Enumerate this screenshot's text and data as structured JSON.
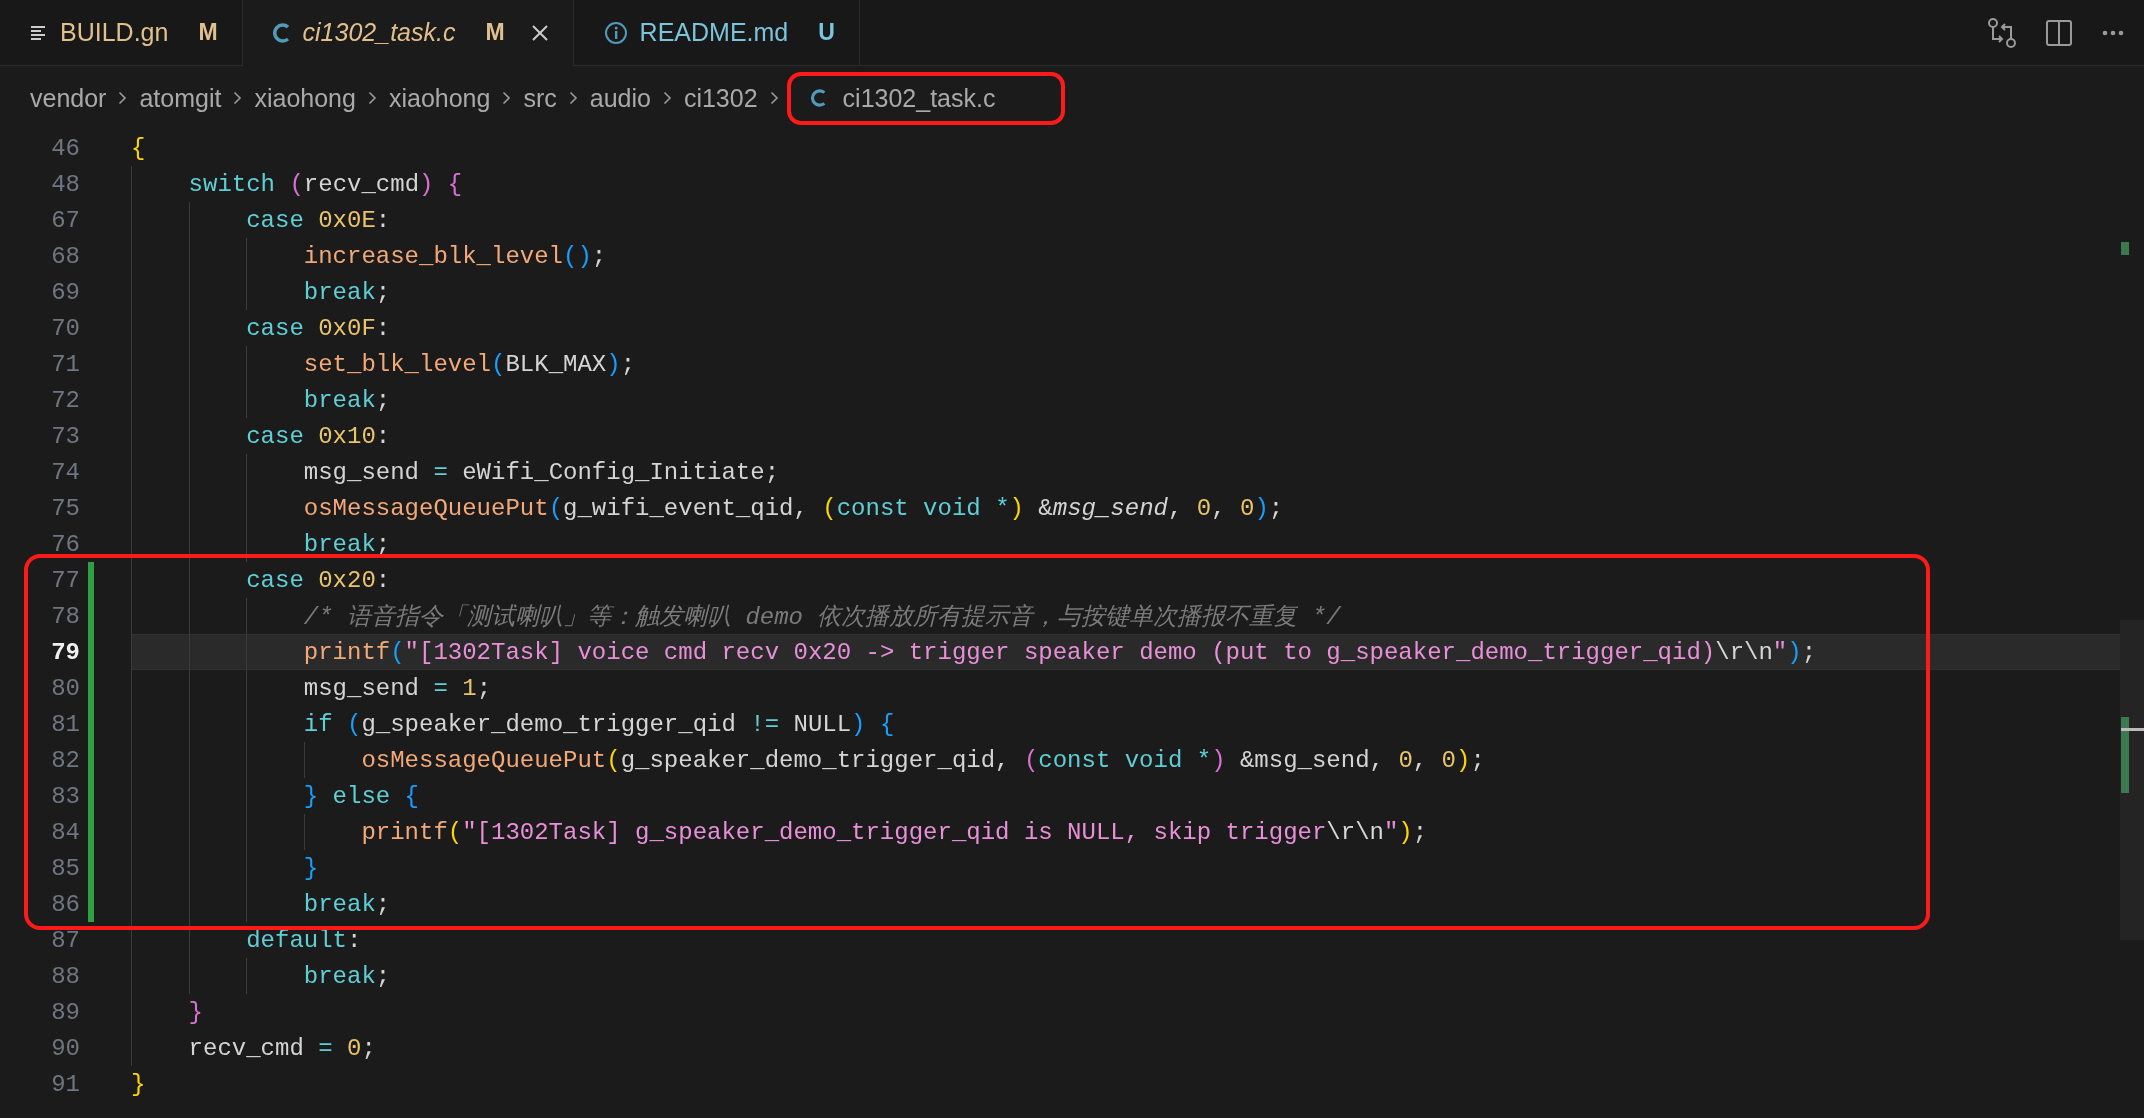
{
  "tabs": [
    {
      "label": "BUILD.gn",
      "status": "M",
      "kind": "lines",
      "selected": false,
      "italic": false,
      "closable": false,
      "color": "#e2c08d"
    },
    {
      "label": "ci1302_task.c",
      "status": "M",
      "kind": "c",
      "selected": true,
      "italic": true,
      "closable": true,
      "color": "#e2c08d"
    },
    {
      "label": "README.md",
      "status": "U",
      "kind": "info",
      "selected": false,
      "italic": false,
      "closable": false,
      "color": "#7cc3dc"
    }
  ],
  "breadcrumb": [
    {
      "label": "vendor",
      "kind": "folder",
      "boxed": false
    },
    {
      "label": "atomgit",
      "kind": "folder",
      "boxed": false
    },
    {
      "label": "xiaohong",
      "kind": "folder",
      "boxed": false
    },
    {
      "label": "xiaohong",
      "kind": "folder",
      "boxed": false
    },
    {
      "label": "src",
      "kind": "folder",
      "boxed": false
    },
    {
      "label": "audio",
      "kind": "folder",
      "boxed": false
    },
    {
      "label": "ci1302",
      "kind": "folder",
      "boxed": false
    },
    {
      "label": "ci1302_task.c",
      "kind": "c",
      "boxed": true
    }
  ],
  "lines": [
    {
      "number": "46",
      "changed": false,
      "current": false,
      "boxed": false,
      "tokens": [
        {
          "text": "{",
          "kind": "bracket1"
        }
      ],
      "children": [
        {
          "number": "48",
          "changed": false,
          "current": false,
          "boxed": false,
          "tokens": [
            {
              "text": "switch",
              "kind": "keyword"
            },
            {
              "text": " (",
              "kind": "bracket2"
            },
            {
              "text": "recv_cmd",
              "kind": "plain"
            },
            {
              "text": ")",
              "kind": "bracket2"
            },
            {
              "text": " {",
              "kind": "bracket2"
            }
          ],
          "children": [
            {
              "number": "67",
              "changed": false,
              "current": false,
              "boxed": false,
              "tokens": [
                {
                  "text": "case",
                  "kind": "keyword"
                },
                {
                  "text": " 0x0E",
                  "kind": "number"
                },
                {
                  "text": ":",
                  "kind": "plain"
                }
              ],
              "children": [
                {
                  "number": "68",
                  "changed": false,
                  "current": false,
                  "boxed": false,
                  "tokens": [
                    {
                      "text": "increase_blk_level",
                      "kind": "function"
                    },
                    {
                      "text": "()",
                      "kind": "bracket3"
                    },
                    {
                      "text": ";",
                      "kind": "plain"
                    }
                  ]
                },
                {
                  "number": "69",
                  "changed": false,
                  "current": false,
                  "boxed": false,
                  "tokens": [
                    {
                      "text": "break",
                      "kind": "keyword"
                    },
                    {
                      "text": ";",
                      "kind": "plain"
                    }
                  ]
                }
              ]
            },
            {
              "number": "70",
              "changed": false,
              "current": false,
              "boxed": false,
              "tokens": [
                {
                  "text": "case",
                  "kind": "keyword"
                },
                {
                  "text": " 0x0F",
                  "kind": "number"
                },
                {
                  "text": ":",
                  "kind": "plain"
                }
              ],
              "children": [
                {
                  "number": "71",
                  "changed": false,
                  "current": false,
                  "boxed": false,
                  "tokens": [
                    {
                      "text": "set_blk_level",
                      "kind": "function"
                    },
                    {
                      "text": "(",
                      "kind": "bracket3"
                    },
                    {
                      "text": "BLK_MAX",
                      "kind": "plain"
                    },
                    {
                      "text": ")",
                      "kind": "bracket3"
                    },
                    {
                      "text": ";",
                      "kind": "plain"
                    }
                  ]
                },
                {
                  "number": "72",
                  "changed": false,
                  "current": false,
                  "boxed": false,
                  "tokens": [
                    {
                      "text": "break",
                      "kind": "keyword"
                    },
                    {
                      "text": ";",
                      "kind": "plain"
                    }
                  ]
                }
              ]
            },
            {
              "number": "73",
              "changed": false,
              "current": false,
              "boxed": false,
              "tokens": [
                {
                  "text": "case",
                  "kind": "keyword"
                },
                {
                  "text": " 0x10",
                  "kind": "number"
                },
                {
                  "text": ":",
                  "kind": "plain"
                }
              ],
              "children": [
                {
                  "number": "74",
                  "changed": false,
                  "current": false,
                  "boxed": false,
                  "tokens": [
                    {
                      "text": "msg_send ",
                      "kind": "plain"
                    },
                    {
                      "text": "=",
                      "kind": "operator"
                    },
                    {
                      "text": " eWifi_Config_Initiate;",
                      "kind": "plain"
                    }
                  ]
                },
                {
                  "number": "75",
                  "changed": false,
                  "current": false,
                  "boxed": false,
                  "tokens": [
                    {
                      "text": "osMessageQueuePut",
                      "kind": "function"
                    },
                    {
                      "text": "(",
                      "kind": "bracket3"
                    },
                    {
                      "text": "g_wifi_event_qid, ",
                      "kind": "plain"
                    },
                    {
                      "text": "(",
                      "kind": "bracket1"
                    },
                    {
                      "text": "const void ",
                      "kind": "keyword"
                    },
                    {
                      "text": "*",
                      "kind": "operator"
                    },
                    {
                      "text": ")",
                      "kind": "bracket1"
                    },
                    {
                      "text": " &",
                      "kind": "plain"
                    },
                    {
                      "text": "msg_send",
                      "kind": "italic"
                    },
                    {
                      "text": ", ",
                      "kind": "plain"
                    },
                    {
                      "text": "0",
                      "kind": "number"
                    },
                    {
                      "text": ", ",
                      "kind": "plain"
                    },
                    {
                      "text": "0",
                      "kind": "number"
                    },
                    {
                      "text": ")",
                      "kind": "bracket3"
                    },
                    {
                      "text": ";",
                      "kind": "plain"
                    }
                  ]
                },
                {
                  "number": "76",
                  "changed": false,
                  "current": false,
                  "boxed": false,
                  "tokens": [
                    {
                      "text": "break",
                      "kind": "keyword"
                    },
                    {
                      "text": ";",
                      "kind": "plain"
                    }
                  ]
                }
              ]
            },
            {
              "number": "77",
              "changed": true,
              "current": false,
              "boxed": true,
              "tokens": [
                {
                  "text": "case",
                  "kind": "keyword"
                },
                {
                  "text": " 0x20",
                  "kind": "number"
                },
                {
                  "text": ":",
                  "kind": "plain"
                }
              ],
              "children": [
                {
                  "number": "78",
                  "changed": true,
                  "current": false,
                  "boxed": false,
                  "tokens": [
                    {
                      "text": "/* 语音指令「测试喇叭」等：触发喇叭 demo 依次播放所有提示音，与按键单次播报不重复 */",
                      "kind": "comment"
                    }
                  ]
                },
                {
                  "number": "79",
                  "changed": true,
                  "current": true,
                  "boxed": false,
                  "tokens": [
                    {
                      "text": "printf",
                      "kind": "function"
                    },
                    {
                      "text": "(",
                      "kind": "bracket3"
                    },
                    {
                      "text": "\"[1302Task] voice cmd recv 0x20 -> trigger speaker demo (put to g_speaker_demo_trigger_qid)",
                      "kind": "string"
                    },
                    {
                      "text": "\\r\\n",
                      "kind": "escape"
                    },
                    {
                      "text": "\"",
                      "kind": "string"
                    },
                    {
                      "text": ")",
                      "kind": "bracket3"
                    },
                    {
                      "text": ";",
                      "kind": "plain"
                    }
                  ]
                },
                {
                  "number": "80",
                  "changed": true,
                  "current": false,
                  "boxed": false,
                  "tokens": [
                    {
                      "text": "msg_send ",
                      "kind": "plain"
                    },
                    {
                      "text": "=",
                      "kind": "operator"
                    },
                    {
                      "text": " 1",
                      "kind": "number"
                    },
                    {
                      "text": ";",
                      "kind": "plain"
                    }
                  ]
                },
                {
                  "number": "81",
                  "changed": true,
                  "current": false,
                  "boxed": false,
                  "tokens": [
                    {
                      "text": "if",
                      "kind": "keyword"
                    },
                    {
                      "text": " (",
                      "kind": "bracket3"
                    },
                    {
                      "text": "g_speaker_demo_trigger_qid ",
                      "kind": "plain"
                    },
                    {
                      "text": "!=",
                      "kind": "operator"
                    },
                    {
                      "text": " NULL",
                      "kind": "plain"
                    },
                    {
                      "text": ")",
                      "kind": "bracket3"
                    },
                    {
                      "text": " {",
                      "kind": "bracket3"
                    }
                  ],
                  "children": [
                    {
                      "number": "82",
                      "changed": true,
                      "current": false,
                      "boxed": false,
                      "tokens": [
                        {
                          "text": "osMessageQueuePut",
                          "kind": "function"
                        },
                        {
                          "text": "(",
                          "kind": "bracket1"
                        },
                        {
                          "text": "g_speaker_demo_trigger_qid, ",
                          "kind": "plain"
                        },
                        {
                          "text": "(",
                          "kind": "bracket2"
                        },
                        {
                          "text": "const void ",
                          "kind": "keyword"
                        },
                        {
                          "text": "*",
                          "kind": "operator"
                        },
                        {
                          "text": ")",
                          "kind": "bracket2"
                        },
                        {
                          "text": " &msg_send, ",
                          "kind": "plain"
                        },
                        {
                          "text": "0",
                          "kind": "number"
                        },
                        {
                          "text": ", ",
                          "kind": "plain"
                        },
                        {
                          "text": "0",
                          "kind": "number"
                        },
                        {
                          "text": ")",
                          "kind": "bracket1"
                        },
                        {
                          "text": ";",
                          "kind": "plain"
                        }
                      ]
                    }
                  ]
                },
                {
                  "number": "83",
                  "changed": true,
                  "current": false,
                  "boxed": false,
                  "tokens": [
                    {
                      "text": "}",
                      "kind": "bracket3"
                    },
                    {
                      "text": " else",
                      "kind": "keyword"
                    },
                    {
                      "text": " {",
                      "kind": "bracket3"
                    }
                  ],
                  "children": [
                    {
                      "number": "84",
                      "changed": true,
                      "current": false,
                      "boxed": false,
                      "tokens": [
                        {
                          "text": "printf",
                          "kind": "function"
                        },
                        {
                          "text": "(",
                          "kind": "bracket1"
                        },
                        {
                          "text": "\"[1302Task] g_speaker_demo_trigger_qid is NULL, skip trigger",
                          "kind": "string"
                        },
                        {
                          "text": "\\r\\n",
                          "kind": "escape"
                        },
                        {
                          "text": "\"",
                          "kind": "string"
                        },
                        {
                          "text": ")",
                          "kind": "bracket1"
                        },
                        {
                          "text": ";",
                          "kind": "plain"
                        }
                      ]
                    }
                  ]
                },
                {
                  "number": "85",
                  "changed": true,
                  "current": false,
                  "boxed": false,
                  "tokens": [
                    {
                      "text": "}",
                      "kind": "bracket3"
                    }
                  ]
                },
                {
                  "number": "86",
                  "changed": true,
                  "current": false,
                  "boxed": false,
                  "tokens": [
                    {
                      "text": "break",
                      "kind": "keyword"
                    },
                    {
                      "text": ";",
                      "kind": "plain"
                    }
                  ]
                }
              ]
            },
            {
              "number": "87",
              "changed": false,
              "current": false,
              "boxed": false,
              "tokens": [
                {
                  "text": "default",
                  "kind": "keyword"
                },
                {
                  "text": ":",
                  "kind": "plain"
                }
              ],
              "children": [
                {
                  "number": "88",
                  "changed": false,
                  "current": false,
                  "boxed": false,
                  "tokens": [
                    {
                      "text": "break",
                      "kind": "keyword"
                    },
                    {
                      "text": ";",
                      "kind": "plain"
                    }
                  ]
                }
              ]
            }
          ]
        },
        {
          "number": "89",
          "changed": false,
          "current": false,
          "boxed": false,
          "tokens": [
            {
              "text": "}",
              "kind": "bracket2"
            }
          ]
        },
        {
          "number": "90",
          "changed": false,
          "current": false,
          "boxed": false,
          "tokens": [
            {
              "text": "recv_cmd ",
              "kind": "plain"
            },
            {
              "text": "=",
              "kind": "operator"
            },
            {
              "text": " 0",
              "kind": "number"
            },
            {
              "text": ";",
              "kind": "plain"
            }
          ]
        }
      ]
    },
    {
      "number": "91",
      "changed": false,
      "current": false,
      "boxed": false,
      "tokens": [
        {
          "text": "}",
          "kind": "bracket1"
        }
      ]
    }
  ]
}
